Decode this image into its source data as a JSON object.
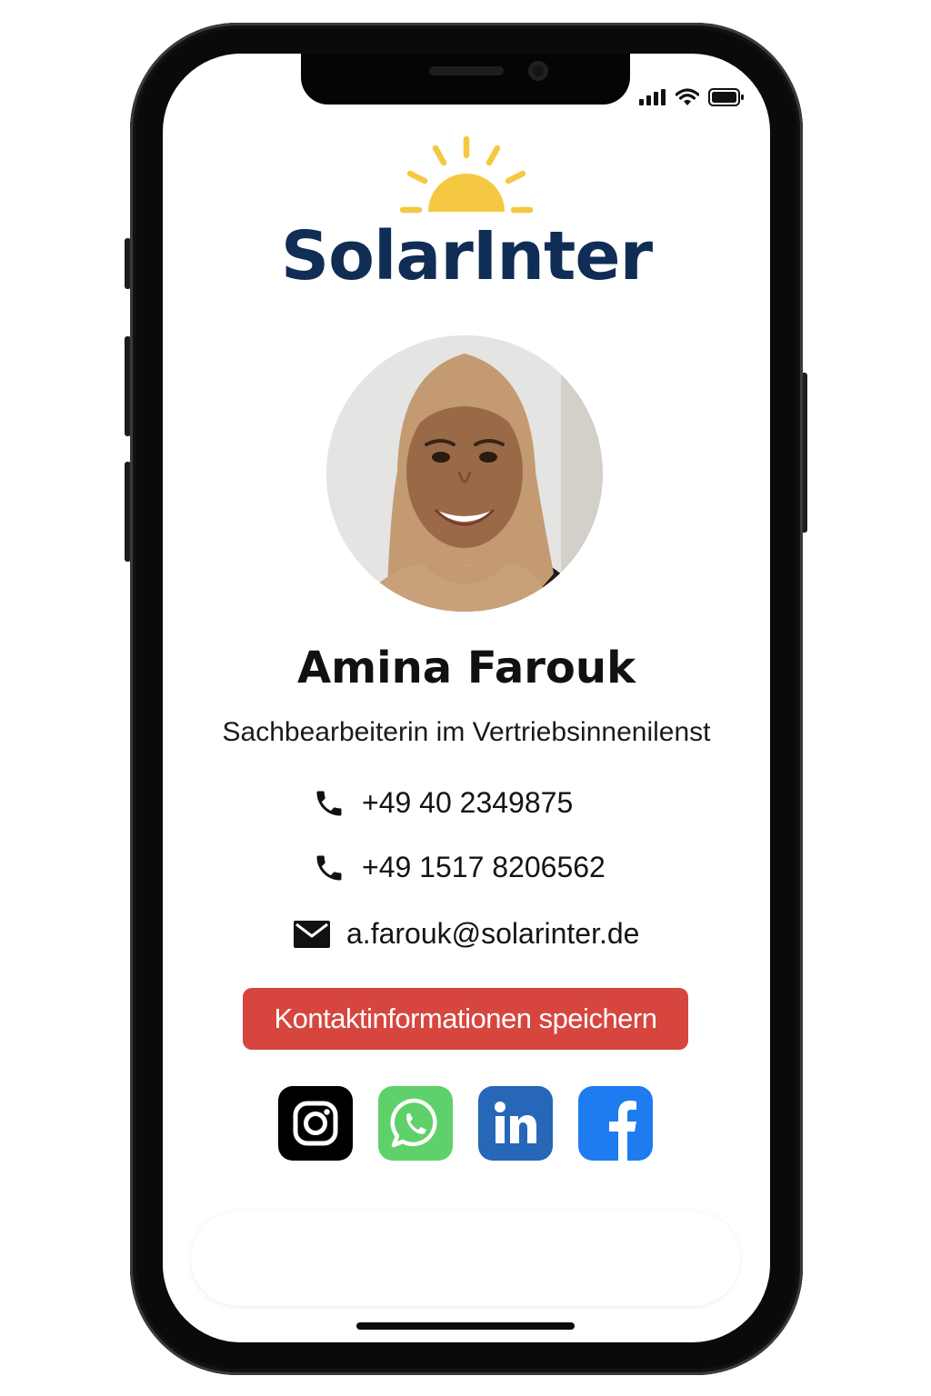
{
  "status_bar": {
    "icons": [
      "signal-bars-icon",
      "wifi-icon",
      "battery-icon"
    ]
  },
  "brand": {
    "logo_text": "SolarInter",
    "logo_icon": "sun-icon",
    "sun_color": "#f5c842",
    "text_color": "#0f2d55"
  },
  "profile": {
    "photo": "profile-photo",
    "name": "Amina Farouk",
    "title": "Sachbearbeiterin im Vertriebsinnenilenst"
  },
  "contacts": [
    {
      "icon": "phone-icon",
      "value": "+49 40 2349875"
    },
    {
      "icon": "phone-icon",
      "value": "+49 1517 8206562"
    },
    {
      "icon": "mail-icon",
      "value": "a.farouk@solarinter.de"
    }
  ],
  "actions": {
    "save_label": "Kontaktinformationen speichern",
    "save_color": "#d7463e"
  },
  "social": [
    {
      "icon": "instagram-icon",
      "color": "#000000"
    },
    {
      "icon": "whatsapp-icon",
      "color": "#5fd16a"
    },
    {
      "icon": "linkedin-icon",
      "color": "#2667b8"
    },
    {
      "icon": "facebook-icon",
      "color": "#1f7cf0"
    }
  ]
}
